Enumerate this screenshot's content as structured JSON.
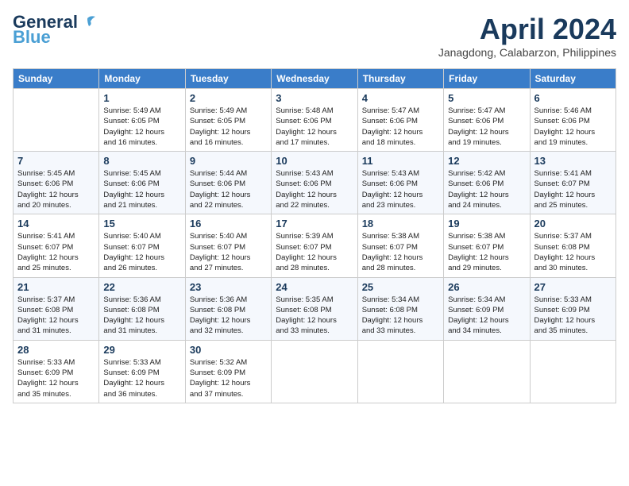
{
  "header": {
    "logo_line1": "General",
    "logo_line2": "Blue",
    "month_title": "April 2024",
    "location": "Janagdong, Calabarzon, Philippines"
  },
  "days_of_week": [
    "Sunday",
    "Monday",
    "Tuesday",
    "Wednesday",
    "Thursday",
    "Friday",
    "Saturday"
  ],
  "weeks": [
    [
      {
        "day": "",
        "info": ""
      },
      {
        "day": "1",
        "info": "Sunrise: 5:49 AM\nSunset: 6:05 PM\nDaylight: 12 hours\nand 16 minutes."
      },
      {
        "day": "2",
        "info": "Sunrise: 5:49 AM\nSunset: 6:05 PM\nDaylight: 12 hours\nand 16 minutes."
      },
      {
        "day": "3",
        "info": "Sunrise: 5:48 AM\nSunset: 6:06 PM\nDaylight: 12 hours\nand 17 minutes."
      },
      {
        "day": "4",
        "info": "Sunrise: 5:47 AM\nSunset: 6:06 PM\nDaylight: 12 hours\nand 18 minutes."
      },
      {
        "day": "5",
        "info": "Sunrise: 5:47 AM\nSunset: 6:06 PM\nDaylight: 12 hours\nand 19 minutes."
      },
      {
        "day": "6",
        "info": "Sunrise: 5:46 AM\nSunset: 6:06 PM\nDaylight: 12 hours\nand 19 minutes."
      }
    ],
    [
      {
        "day": "7",
        "info": ""
      },
      {
        "day": "8",
        "info": "Sunrise: 5:45 AM\nSunset: 6:06 PM\nDaylight: 12 hours\nand 21 minutes."
      },
      {
        "day": "9",
        "info": "Sunrise: 5:44 AM\nSunset: 6:06 PM\nDaylight: 12 hours\nand 22 minutes."
      },
      {
        "day": "10",
        "info": "Sunrise: 5:43 AM\nSunset: 6:06 PM\nDaylight: 12 hours\nand 22 minutes."
      },
      {
        "day": "11",
        "info": "Sunrise: 5:43 AM\nSunset: 6:06 PM\nDaylight: 12 hours\nand 23 minutes."
      },
      {
        "day": "12",
        "info": "Sunrise: 5:42 AM\nSunset: 6:06 PM\nDaylight: 12 hours\nand 24 minutes."
      },
      {
        "day": "13",
        "info": "Sunrise: 5:41 AM\nSunset: 6:07 PM\nDaylight: 12 hours\nand 25 minutes."
      }
    ],
    [
      {
        "day": "14",
        "info": ""
      },
      {
        "day": "15",
        "info": "Sunrise: 5:40 AM\nSunset: 6:07 PM\nDaylight: 12 hours\nand 26 minutes."
      },
      {
        "day": "16",
        "info": "Sunrise: 5:40 AM\nSunset: 6:07 PM\nDaylight: 12 hours\nand 27 minutes."
      },
      {
        "day": "17",
        "info": "Sunrise: 5:39 AM\nSunset: 6:07 PM\nDaylight: 12 hours\nand 28 minutes."
      },
      {
        "day": "18",
        "info": "Sunrise: 5:38 AM\nSunset: 6:07 PM\nDaylight: 12 hours\nand 28 minutes."
      },
      {
        "day": "19",
        "info": "Sunrise: 5:38 AM\nSunset: 6:07 PM\nDaylight: 12 hours\nand 29 minutes."
      },
      {
        "day": "20",
        "info": "Sunrise: 5:37 AM\nSunset: 6:08 PM\nDaylight: 12 hours\nand 30 minutes."
      }
    ],
    [
      {
        "day": "21",
        "info": ""
      },
      {
        "day": "22",
        "info": "Sunrise: 5:36 AM\nSunset: 6:08 PM\nDaylight: 12 hours\nand 31 minutes."
      },
      {
        "day": "23",
        "info": "Sunrise: 5:36 AM\nSunset: 6:08 PM\nDaylight: 12 hours\nand 32 minutes."
      },
      {
        "day": "24",
        "info": "Sunrise: 5:35 AM\nSunset: 6:08 PM\nDaylight: 12 hours\nand 33 minutes."
      },
      {
        "day": "25",
        "info": "Sunrise: 5:34 AM\nSunset: 6:08 PM\nDaylight: 12 hours\nand 33 minutes."
      },
      {
        "day": "26",
        "info": "Sunrise: 5:34 AM\nSunset: 6:09 PM\nDaylight: 12 hours\nand 34 minutes."
      },
      {
        "day": "27",
        "info": "Sunrise: 5:33 AM\nSunset: 6:09 PM\nDaylight: 12 hours\nand 35 minutes."
      }
    ],
    [
      {
        "day": "28",
        "info": "Sunrise: 5:33 AM\nSunset: 6:09 PM\nDaylight: 12 hours\nand 35 minutes."
      },
      {
        "day": "29",
        "info": "Sunrise: 5:33 AM\nSunset: 6:09 PM\nDaylight: 12 hours\nand 36 minutes."
      },
      {
        "day": "30",
        "info": "Sunrise: 5:32 AM\nSunset: 6:09 PM\nDaylight: 12 hours\nand 37 minutes."
      },
      {
        "day": "",
        "info": ""
      },
      {
        "day": "",
        "info": ""
      },
      {
        "day": "",
        "info": ""
      },
      {
        "day": "",
        "info": ""
      }
    ]
  ],
  "week7_sunday_info": "Sunrise: 5:45 AM\nSunset: 6:06 PM\nDaylight: 12 hours\nand 20 minutes.",
  "week14_sunday_info": "Sunrise: 5:41 AM\nSunset: 6:07 PM\nDaylight: 12 hours\nand 25 minutes.",
  "week21_sunday_info": "Sunrise: 5:37 AM\nSunset: 6:08 PM\nDaylight: 12 hours\nand 31 minutes."
}
